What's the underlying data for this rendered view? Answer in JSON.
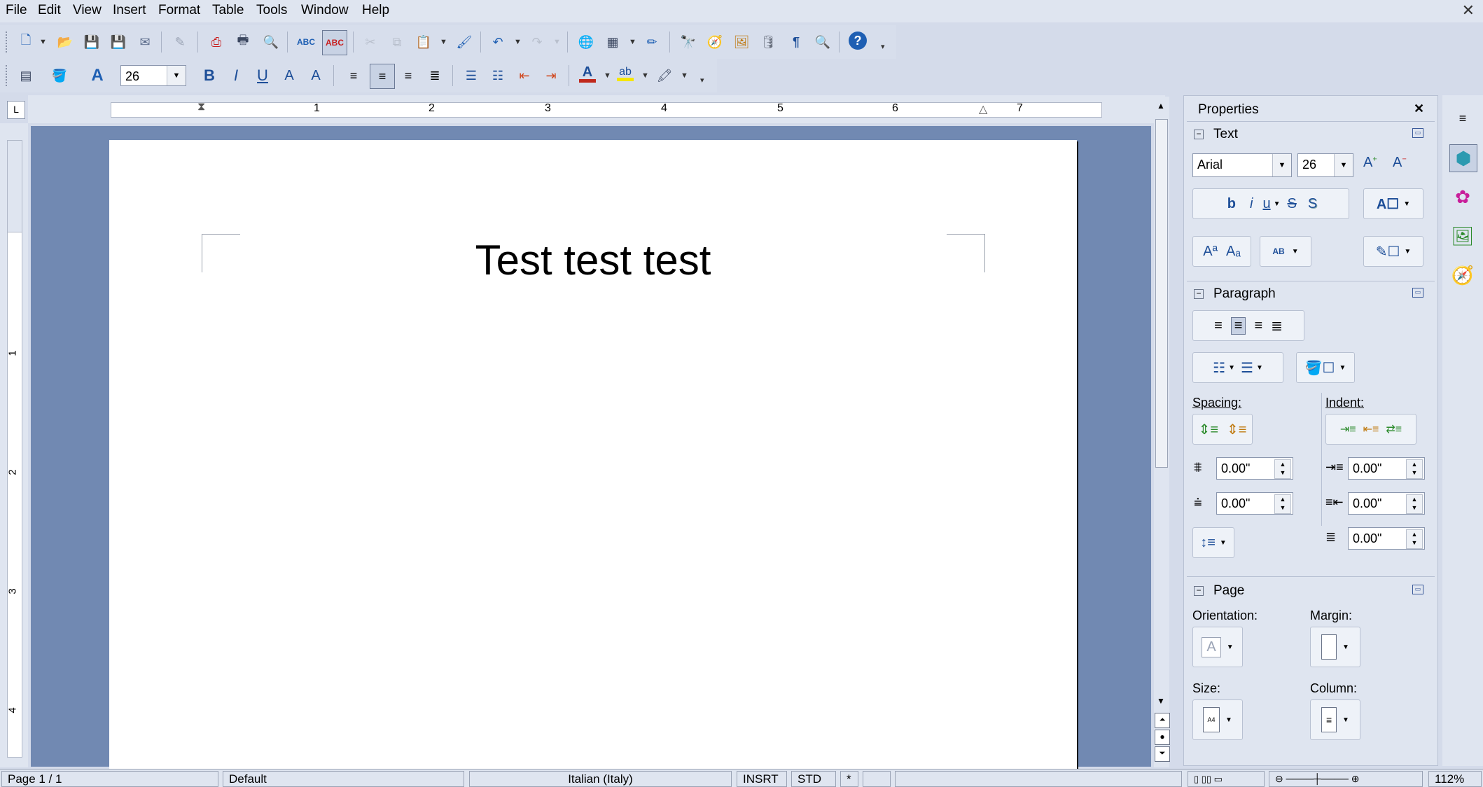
{
  "menubar": {
    "items": [
      "File",
      "Edit",
      "View",
      "Insert",
      "Format",
      "Table",
      "Tools",
      "Window",
      "Help"
    ],
    "close": "✕"
  },
  "formatting": {
    "font_size": "26"
  },
  "ruler": {
    "numbers": [
      "1",
      "2",
      "3",
      "4",
      "5",
      "6",
      "7"
    ],
    "vnumbers": [
      "1",
      "2",
      "3",
      "4"
    ]
  },
  "document": {
    "text": "Test test test"
  },
  "sidebar": {
    "title": "Properties",
    "close": "✕",
    "text_section": {
      "title": "Text",
      "font_name": "Arial",
      "font_size": "26"
    },
    "paragraph_section": {
      "title": "Paragraph",
      "spacing_label": "Spacing:",
      "indent_label": "Indent:",
      "above_spacing": "0.00\"",
      "below_spacing": "0.00\"",
      "before_indent": "0.00\"",
      "after_indent": "0.00\"",
      "first_line_indent": "0.00\""
    },
    "page_section": {
      "title": "Page",
      "orientation_label": "Orientation:",
      "margin_label": "Margin:",
      "size_label": "Size:",
      "column_label": "Column:"
    }
  },
  "statusbar": {
    "page": "Page 1 / 1",
    "style": "Default",
    "language": "Italian (Italy)",
    "insert_mode": "INSRT",
    "selection_mode": "STD",
    "modified": "*",
    "zoom": "112%"
  },
  "colors": {
    "doc_background": "#7189b2",
    "toolbar": "#d7deec",
    "font_color_bar": "#c0281c",
    "highlight_bar": "#f5e600"
  }
}
